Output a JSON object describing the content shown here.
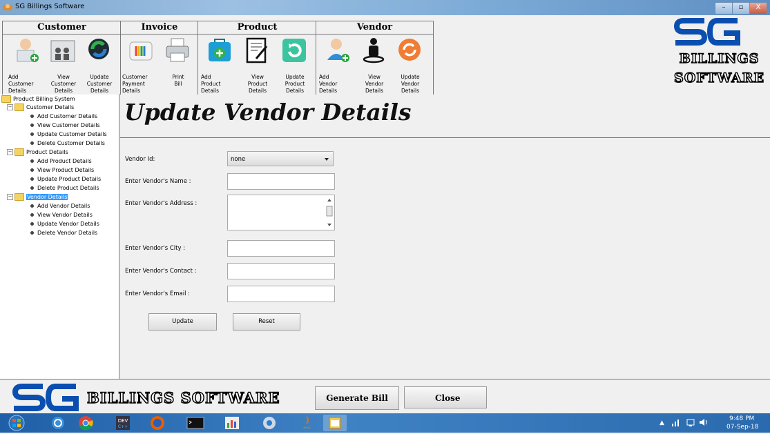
{
  "window": {
    "title": "SG Billings Software",
    "minimize": "–",
    "maximize": "▫",
    "close": "X"
  },
  "toolbar": {
    "customer": {
      "title": "Customer",
      "items": [
        {
          "label": "Add\nCustomer\nDetails"
        },
        {
          "label": "View\nCustomer\nDetails"
        },
        {
          "label": "Update\nCustomer\nDetails"
        }
      ]
    },
    "invoice": {
      "title": "Invoice",
      "items": [
        {
          "label": "Customer\nPayment\nDetails"
        },
        {
          "label": "Print\nBill"
        }
      ]
    },
    "product": {
      "title": "Product",
      "items": [
        {
          "label": "Add\nProduct\nDetails"
        },
        {
          "label": "View\nProduct\nDetails"
        },
        {
          "label": "Update\nProduct\nDetails"
        }
      ]
    },
    "vendor": {
      "title": "Vendor",
      "items": [
        {
          "label": "Add\nVendor\nDetails"
        },
        {
          "label": "View\nVendor\nDetails"
        },
        {
          "label": "Update\nVendor\nDetails"
        }
      ]
    }
  },
  "logo": {
    "line1": "BILLINGS",
    "line2": "SOFTWARE"
  },
  "tree": {
    "root": "Product Billing System",
    "customer": {
      "label": "Customer Details",
      "items": [
        "Add Customer Details",
        "View Customer Details",
        "Update Customer Details",
        "Delete Customer Details"
      ]
    },
    "product": {
      "label": "Product Details",
      "items": [
        "Add Product Details",
        "View Product Details",
        "Update Product Details",
        "Delete Product Details"
      ]
    },
    "vendor": {
      "label": "Vendor Details",
      "items": [
        "Add Vendor Details",
        "View Vendor Details",
        "Update Vendor Details",
        "Delete Vendor Details"
      ]
    }
  },
  "form": {
    "heading": "Update Vendor Details",
    "vendor_id_label": "Vendor Id:",
    "vendor_id_value": "none",
    "name_label": "Enter Vendor's Name :",
    "address_label": "Enter Vendor's Address :",
    "city_label": "Enter Vendor's City :",
    "contact_label": "Enter Vendor's Contact :",
    "email_label": "Enter Vendor's Email :",
    "update_button": "Update",
    "reset_button": "Reset"
  },
  "bottom": {
    "brand": "BILLINGS SOFTWARE",
    "generate_bill": "Generate Bill",
    "close": "Close"
  },
  "taskbar": {
    "time": "9:48 PM",
    "date": "07-Sep-18"
  }
}
